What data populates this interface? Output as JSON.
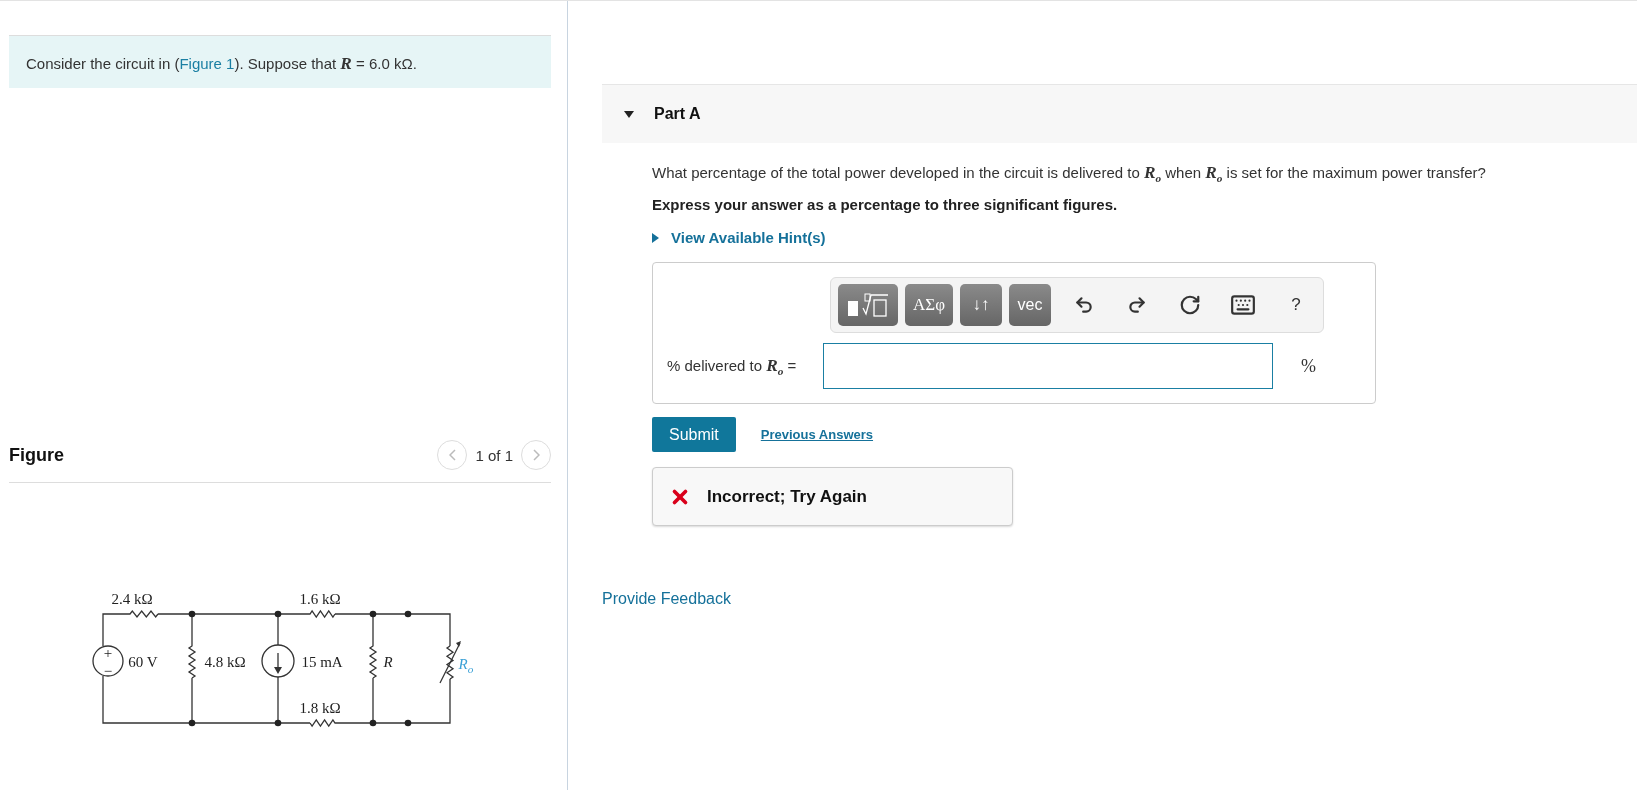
{
  "problem": {
    "before": "Consider the circuit in (",
    "link": "Figure 1",
    "after": "). Suppose that *R* = 6.0 kΩ."
  },
  "figure": {
    "title": "Figure",
    "pager": "1 of 1",
    "prev_disabled": true,
    "next_disabled": true,
    "labels": [
      "2.4 kΩ",
      "1.6 kΩ",
      "+",
      "−",
      "60 V",
      "4.8 kΩ",
      "15 mA",
      "*R*",
      "*R*$_{o}$",
      "1.8 kΩ"
    ]
  },
  "part": {
    "title": "Part A",
    "expanded": true,
    "question": "What percentage of the total power developed in the circuit is delivered to *R*$_{o}$ when *R*$_{o}$ is set for the maximum power transfer?",
    "instruction": "Express your answer as a percentage to three significant figures.",
    "hint": {
      "label": "View Available Hint(s)",
      "expanded": false
    },
    "toolbar": [
      {
        "kind": "template"
      },
      {
        "kind": "text",
        "label": "ΑΣφ"
      },
      {
        "kind": "text",
        "label": "↓↑"
      },
      {
        "kind": "text",
        "label": "vec"
      },
      {
        "kind": "undo"
      },
      {
        "kind": "redo"
      },
      {
        "kind": "reset"
      },
      {
        "kind": "keyboard"
      },
      {
        "kind": "plain",
        "label": "?"
      }
    ],
    "answer_label": "% delivered to *R*$_{o}$ =",
    "unit": "%",
    "submit": "Submit",
    "previous": "Previous Answers",
    "feedback": {
      "correct": false,
      "message": "Incorrect; Try Again"
    }
  },
  "provide_feedback": "Provide Feedback"
}
